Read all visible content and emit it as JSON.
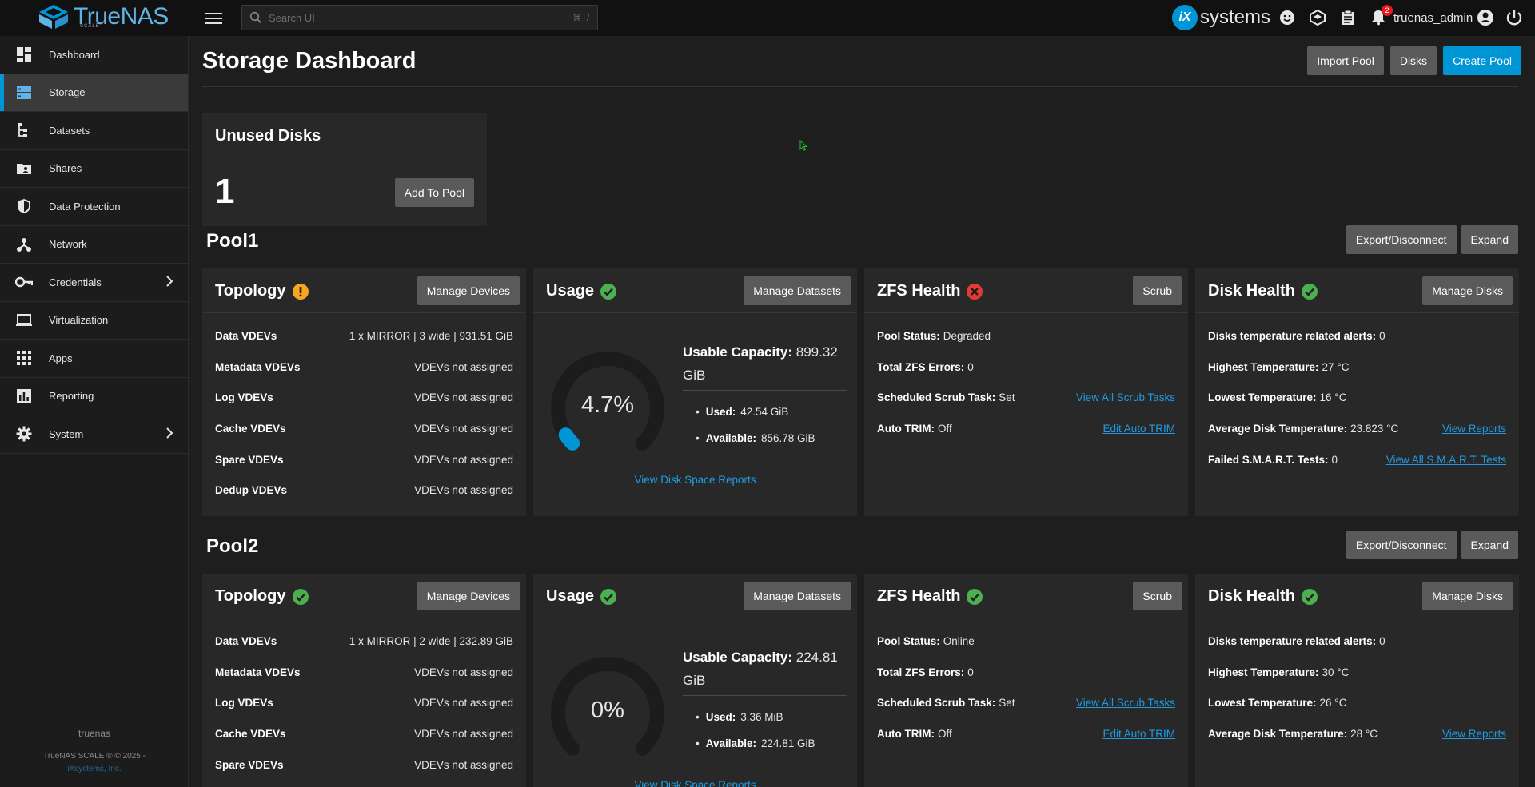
{
  "app": {
    "logo_text": "TrueNAS",
    "logo_sub": "SCALE",
    "vendor": "systems",
    "vendor_badge": "iX"
  },
  "topbar": {
    "search_placeholder": "Search UI",
    "search_hint": "⌘+/",
    "notification_count": "2",
    "username": "truenas_admin"
  },
  "sidebar": {
    "items": [
      {
        "label": "Dashboard",
        "icon": "dashboard-icon"
      },
      {
        "label": "Storage",
        "icon": "storage-icon"
      },
      {
        "label": "Datasets",
        "icon": "datasets-icon"
      },
      {
        "label": "Shares",
        "icon": "shares-icon"
      },
      {
        "label": "Data Protection",
        "icon": "shield-icon"
      },
      {
        "label": "Network",
        "icon": "network-icon"
      },
      {
        "label": "Credentials",
        "icon": "key-icon"
      },
      {
        "label": "Virtualization",
        "icon": "laptop-icon"
      },
      {
        "label": "Apps",
        "icon": "apps-grid-icon"
      },
      {
        "label": "Reporting",
        "icon": "bar-chart-icon"
      },
      {
        "label": "System",
        "icon": "gear-icon"
      }
    ],
    "active": "Storage",
    "hostname": "truenas",
    "copyright": "TrueNAS SCALE ® © 2025 -",
    "company": "iXsystems, Inc."
  },
  "page": {
    "title": "Storage Dashboard",
    "import_pool": "Import Pool",
    "disks": "Disks",
    "create_pool": "Create Pool"
  },
  "unused": {
    "title": "Unused Disks",
    "count": "1",
    "button": "Add To Pool"
  },
  "labels": {
    "export": "Export/Disconnect",
    "expand": "Expand",
    "topology": "Topology",
    "usage": "Usage",
    "zfs_health": "ZFS Health",
    "disk_health": "Disk Health",
    "manage_devices": "Manage Devices",
    "manage_datasets": "Manage Datasets",
    "scrub": "Scrub",
    "manage_disks": "Manage Disks",
    "data_vdevs": "Data VDEVs",
    "metadata_vdevs": "Metadata VDEVs",
    "log_vdevs": "Log VDEVs",
    "cache_vdevs": "Cache VDEVs",
    "spare_vdevs": "Spare VDEVs",
    "dedup_vdevs": "Dedup VDEVs",
    "not_assigned": "VDEVs not assigned",
    "usable_capacity": "Usable Capacity:",
    "used": "Used:",
    "available": "Available:",
    "view_disk_space": "View Disk Space Reports",
    "pool_status": "Pool Status:",
    "total_errors": "Total ZFS Errors:",
    "scrub_task": "Scheduled Scrub Task:",
    "auto_trim": "Auto TRIM:",
    "view_scrub_tasks": "View All Scrub Tasks",
    "edit_auto_trim": "Edit Auto TRIM",
    "temp_alerts": "Disks temperature related alerts:",
    "highest_temp": "Highest Temperature:",
    "lowest_temp": "Lowest Temperature:",
    "avg_temp": "Average Disk Temperature:",
    "failed_smart": "Failed S.M.A.R.T. Tests:",
    "view_reports": "View Reports",
    "view_smart": "View All S.M.A.R.T. Tests"
  },
  "pools": [
    {
      "name": "Pool1",
      "topology_status": "warning",
      "data_vdevs": "1 x MIRROR | 3 wide | 931.51 GiB",
      "usage_percent_text": "4.7%",
      "usage_percent": 4.7,
      "usable_capacity_value": "899.32",
      "usable_capacity_unit": "GiB",
      "used": "42.54 GiB",
      "available": "856.78 GiB",
      "zfs_status": "error",
      "pool_status": "Degraded",
      "total_errors": "0",
      "scrub_task": "Set",
      "auto_trim": "Off",
      "temp_alerts": "0",
      "highest_temp": "27 °C",
      "lowest_temp": "16 °C",
      "avg_temp": "23.823 °C",
      "failed_smart": "0"
    },
    {
      "name": "Pool2",
      "topology_status": "ok",
      "data_vdevs": "1 x MIRROR | 2 wide | 232.89 GiB",
      "usage_percent_text": "0%",
      "usage_percent": 0,
      "usable_capacity_value": "224.81",
      "usable_capacity_unit": "GiB",
      "used": "3.36 MiB",
      "available": "224.81 GiB",
      "zfs_status": "ok",
      "pool_status": "Online",
      "total_errors": "0",
      "scrub_task": "Set",
      "auto_trim": "Off",
      "temp_alerts": "0",
      "highest_temp": "30 °C",
      "lowest_temp": "26 °C",
      "avg_temp": "28 °C"
    }
  ],
  "colors": {
    "accent": "#0095d5",
    "ok": "#4caf50",
    "warning": "#f5a623",
    "error": "#e53935"
  }
}
